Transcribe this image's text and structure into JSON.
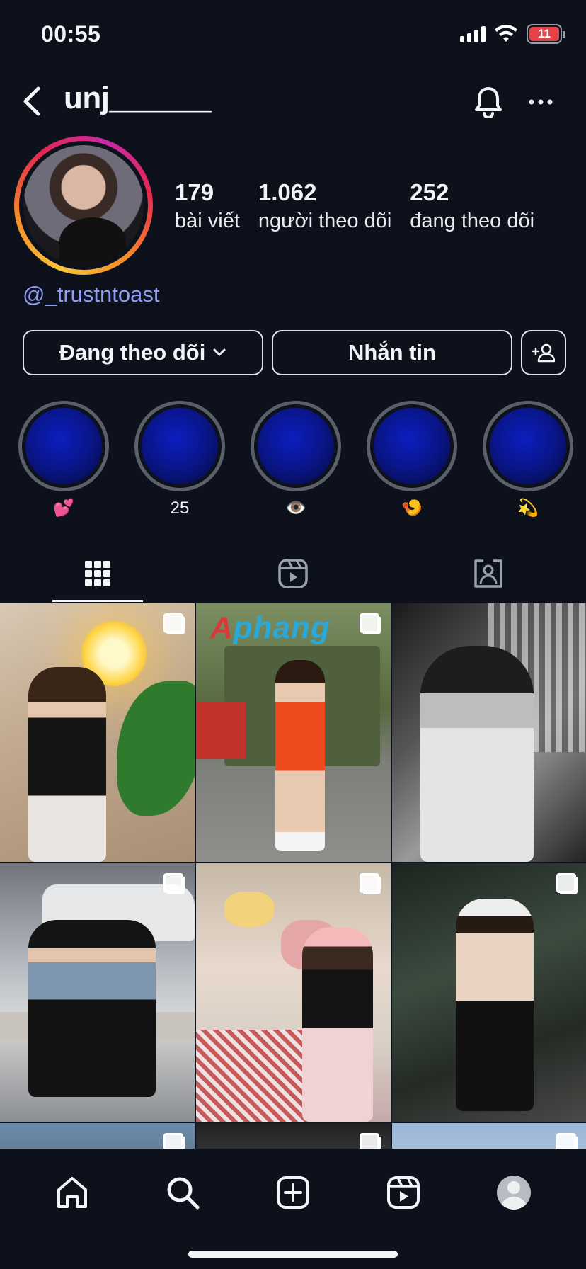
{
  "status_bar": {
    "time": "00:55",
    "battery": "11"
  },
  "header": {
    "username": "unj______",
    "icons": [
      "back-icon",
      "bell-icon",
      "more-icon"
    ]
  },
  "profile": {
    "stats": [
      {
        "value": "179",
        "label": "bài viết"
      },
      {
        "value": "1.062",
        "label": "người theo dõi"
      },
      {
        "value": "252",
        "label": "đang theo dõi"
      }
    ],
    "linked_handle": "@_trustntoast"
  },
  "actions": {
    "following_label": "Đang theo dõi",
    "message_label": "Nhắn tin"
  },
  "highlights": [
    {
      "label": "💕"
    },
    {
      "label": "25"
    },
    {
      "label": "👁️"
    },
    {
      "label": "🍤"
    },
    {
      "label": "💫"
    }
  ],
  "tabs": [
    {
      "name": "grid",
      "icon": "grid-icon",
      "active": true
    },
    {
      "name": "reels",
      "icon": "reels-icon",
      "active": false
    },
    {
      "name": "tagged",
      "icon": "tagged-icon",
      "active": false
    }
  ],
  "posts": {
    "watermark": "Aphang"
  },
  "nav": {
    "items": [
      "home-icon",
      "search-icon",
      "create-icon",
      "reels-icon",
      "profile-avatar"
    ]
  },
  "colors": {
    "background": "#0c111b",
    "link": "#8f9cf7",
    "highlight_fill": "#0a168e",
    "battery_fill": "#e5434a"
  }
}
